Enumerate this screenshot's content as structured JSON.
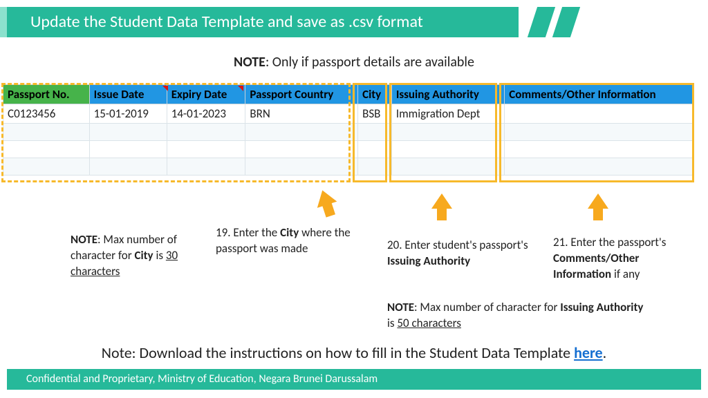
{
  "header": {
    "title": "Update the Student Data Template and save as .csv format"
  },
  "top_note": {
    "label": "NOTE",
    "text": ": Only if passport details are available"
  },
  "table": {
    "headers": [
      "Passport No.",
      "Issue Date",
      "Expiry Date",
      "Passport Country",
      "City",
      "Issuing Authority",
      "Comments/Other Information"
    ],
    "row": {
      "passport_no": "C0123456",
      "issue_date": "15-01-2019",
      "expiry_date": "14-01-2023",
      "passport_country": "BRN",
      "city": "BSB",
      "issuing_authority": "Immigration Dept",
      "comments": ""
    }
  },
  "notes": {
    "city_limit": {
      "label": "NOTE",
      "t1": ": Max number of character for ",
      "bold": "City",
      "t2": " is ",
      "u": "30 characters"
    },
    "step19": {
      "num": "19. Enter the ",
      "bold": "City",
      "rest": " where the passport was made"
    },
    "step20": {
      "num": "20. Enter student's passport's ",
      "bold": "Issuing Authority"
    },
    "step21": {
      "num": "21. Enter the passport's ",
      "bold": "Comments/Other Information",
      "rest": " if any"
    },
    "auth_limit": {
      "label": "NOTE",
      "t1": ": Max number of character for ",
      "bold": "Issuing Authority",
      "t2": " is ",
      "u": "50 characters"
    }
  },
  "bottom": {
    "text": "Note: Download the instructions on how to fill in the Student Data Template ",
    "link": "here",
    "dot": "."
  },
  "footer": {
    "text": "Confidential and Proprietary, Ministry of Education, Negara Brunei Darussalam"
  }
}
